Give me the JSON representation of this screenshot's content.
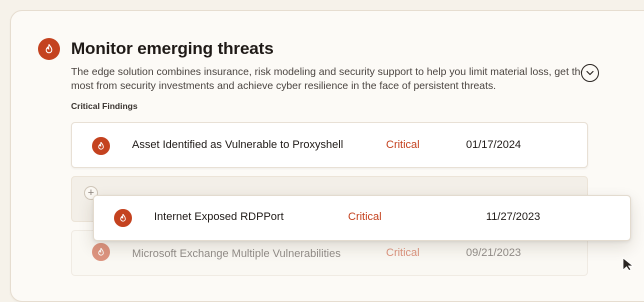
{
  "panel": {
    "title": "Monitor emerging threats",
    "description": "The edge solution combines insurance, risk modeling and security support to help you limit material loss, get the most from security investments and achieve cyber resilience in the face of persistent threats.",
    "section_label": "Critical Findings",
    "icon": "flame-icon",
    "collapse_icon": "chevron-down-icon",
    "accent_color": "#c4421f"
  },
  "findings": [
    {
      "name": "Asset Identified as Vulnerable to Proxyshell",
      "severity": "Critical",
      "date": "01/17/2024"
    },
    {
      "name": "Microsoft Exchange Multiple Vulnerabilities",
      "severity": "Critical",
      "date": "09/21/2023"
    }
  ],
  "dragging_item": {
    "name": "Internet Exposed RDPPort",
    "severity": "Critical",
    "date": "11/27/2023"
  },
  "drop_zone": {
    "add_icon": "plus-icon",
    "add_symbol": "+"
  }
}
